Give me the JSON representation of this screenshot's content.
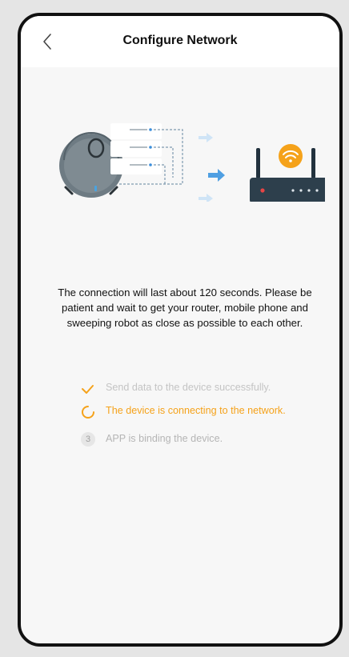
{
  "header": {
    "title": "Configure Network"
  },
  "message": "The connection will last about 120 seconds. Please be patient and wait to get your router, mobile phone and sweeping robot as close as possible to each other.",
  "steps": [
    {
      "status": "done",
      "icon": "check-icon",
      "text": "Send data to the device successfully."
    },
    {
      "status": "active",
      "icon": "loading-spinner-icon",
      "text": "The device is connecting to the network."
    },
    {
      "status": "pending",
      "number": "3",
      "text": "APP is binding the device."
    }
  ],
  "colors": {
    "accent": "#f5a21a",
    "robot": "#6e7b83",
    "router": "#2d3f4c",
    "arrow": "#5aa7e6"
  }
}
